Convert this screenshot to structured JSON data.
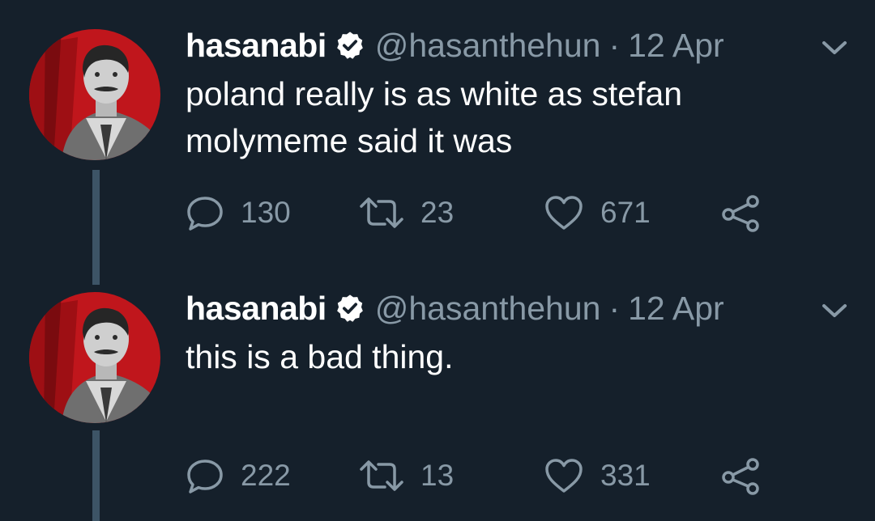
{
  "colors": {
    "background": "#15202b",
    "text": "#ffffff",
    "secondary_text": "#8899a6",
    "thread_line": "#3d5466",
    "avatar_red": "#c0161c"
  },
  "tweets": [
    {
      "name": "hasanabi",
      "handle": "@hasanthehun",
      "separator": "·",
      "date": "12 Apr",
      "text": "poland really is as white as stefan molymeme said it was",
      "replies": "130",
      "retweets": "23",
      "likes": "671",
      "icons": [
        "avatar",
        "verified-icon",
        "chevron-down-icon",
        "reply-icon",
        "retweet-icon",
        "like-icon",
        "share-icon"
      ]
    },
    {
      "name": "hasanabi",
      "handle": "@hasanthehun",
      "separator": "·",
      "date": "12 Apr",
      "text": "this is a bad thing.",
      "replies": "222",
      "retweets": "13",
      "likes": "331",
      "icons": [
        "avatar",
        "verified-icon",
        "chevron-down-icon",
        "reply-icon",
        "retweet-icon",
        "like-icon",
        "share-icon"
      ]
    }
  ]
}
